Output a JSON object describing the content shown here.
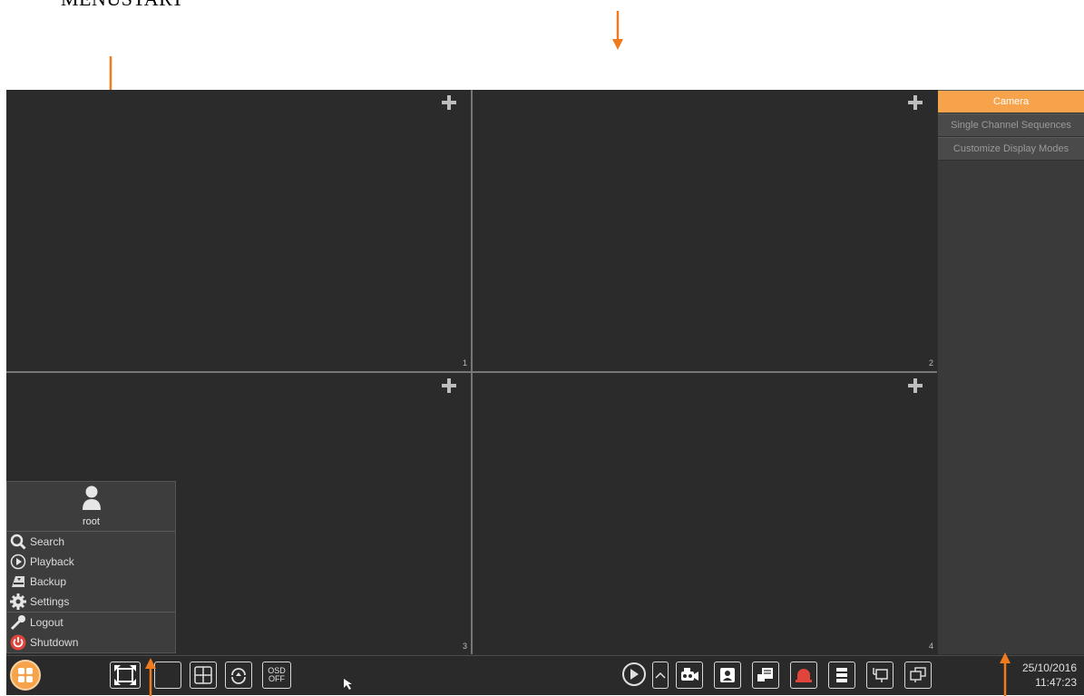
{
  "doc_label": "MENUSTART",
  "tiles": [
    {
      "num": "1"
    },
    {
      "num": "2"
    },
    {
      "num": "3"
    },
    {
      "num": "4"
    }
  ],
  "right_panel": {
    "tabs": [
      "Camera",
      "Single Channel Sequences",
      "Customize Display Modes"
    ],
    "active_tab": "Camera"
  },
  "menu": {
    "username": "root",
    "items": [
      {
        "label": "Search",
        "icon": "search-icon"
      },
      {
        "label": "Playback",
        "icon": "play-circle-icon"
      },
      {
        "label": "Backup",
        "icon": "backup-icon"
      },
      {
        "label": "Settings",
        "icon": "gear-icon"
      },
      {
        "label": "Logout",
        "icon": "key-icon"
      },
      {
        "label": "Shutdown",
        "icon": "power-icon"
      }
    ]
  },
  "taskbar": {
    "osd_line1": "OSD",
    "osd_line2": "OFF",
    "date": "25/10/2016",
    "time": "11:47:23"
  },
  "colors": {
    "accent": "#f7a34b",
    "arrow": "#f07a1e",
    "shutdown": "#e0443a"
  }
}
